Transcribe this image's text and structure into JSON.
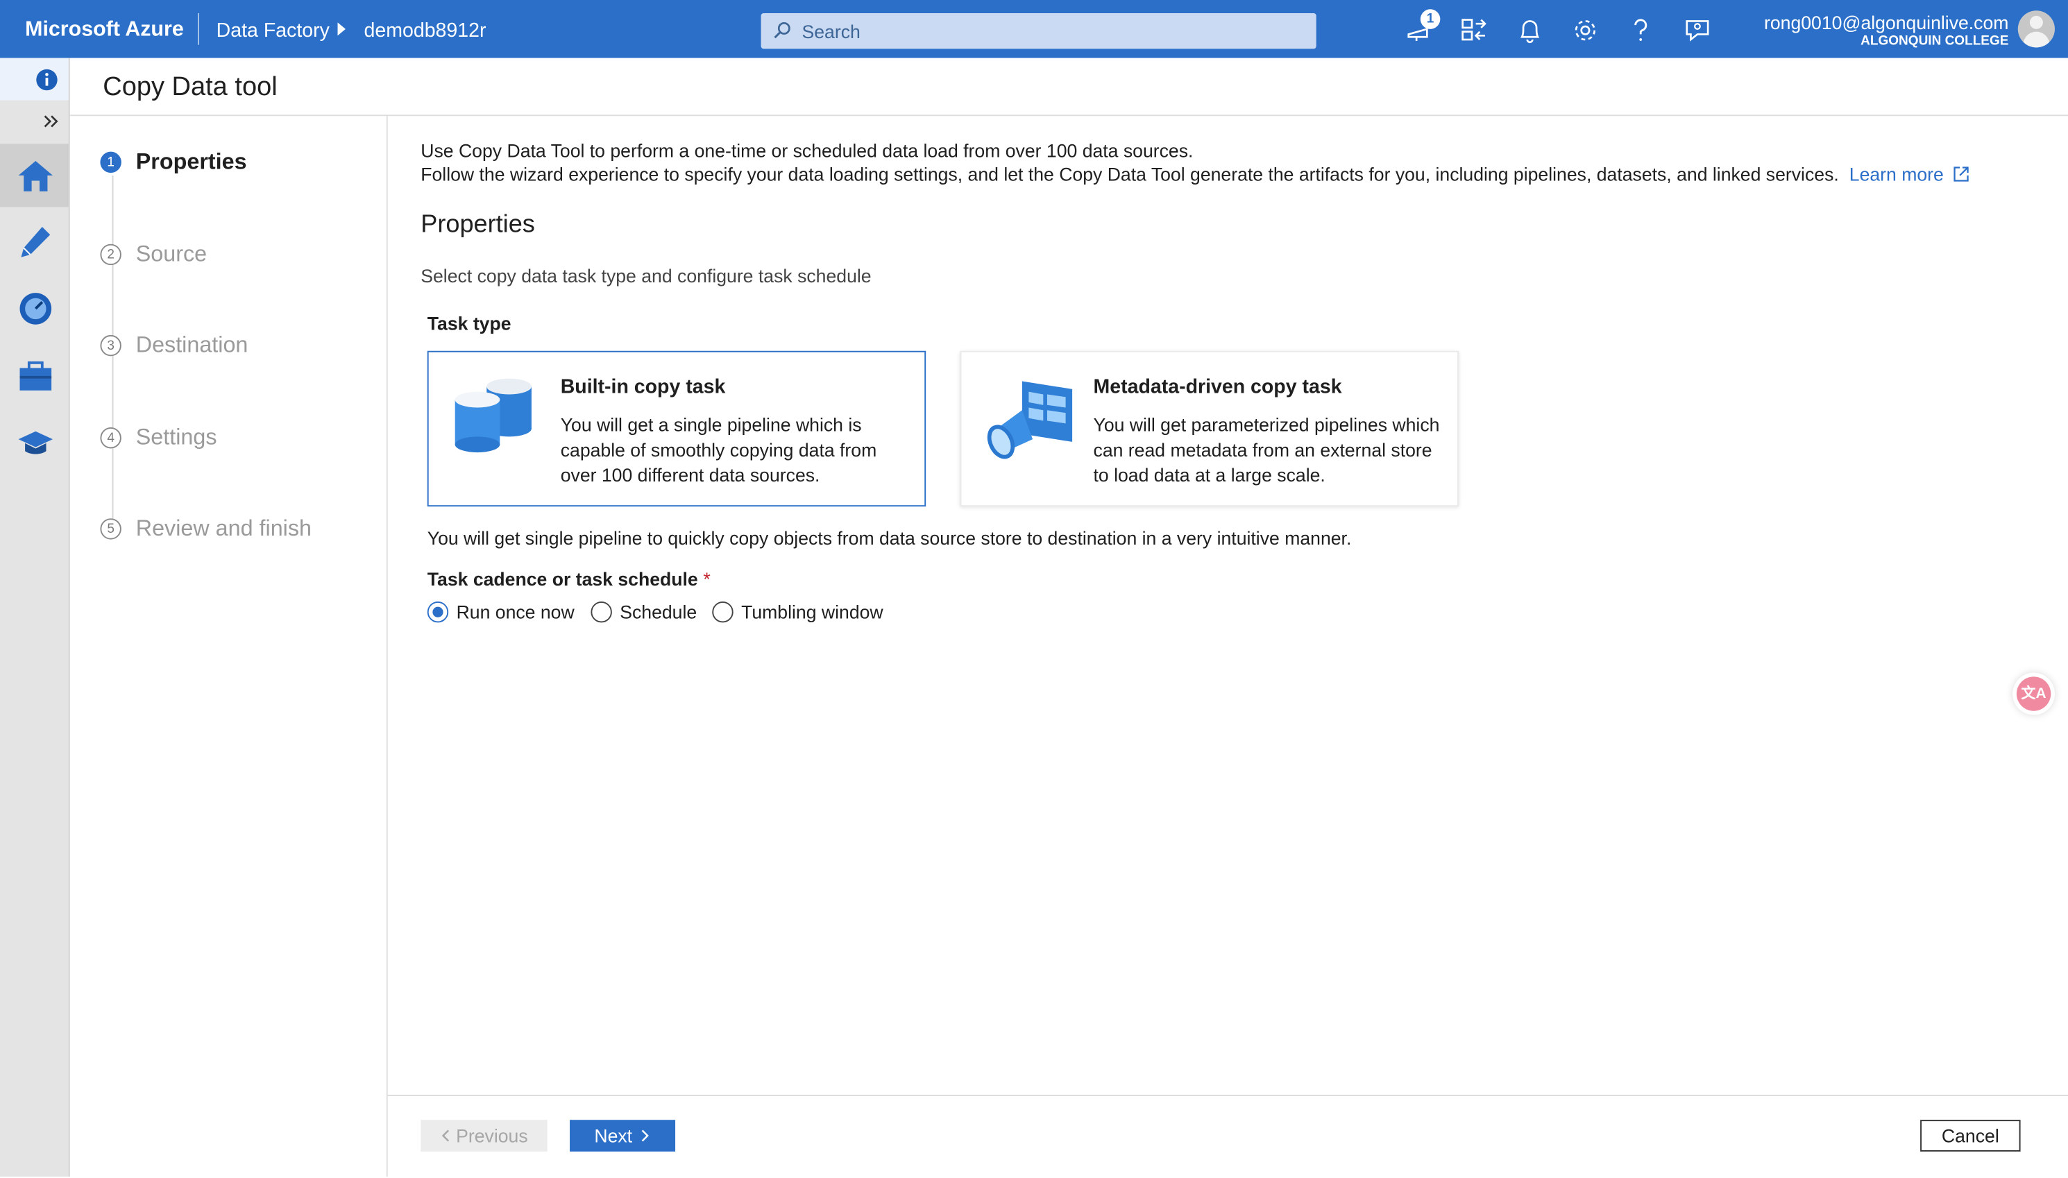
{
  "topbar": {
    "brand": "Microsoft Azure",
    "breadcrumb": [
      "Data Factory",
      "demodb8912r"
    ],
    "search_placeholder": "Search",
    "notification_count": "1",
    "user_email": "rong0010@algonquinlive.com",
    "user_org": "ALGONQUIN COLLEGE",
    "accent_color": "#2b6fc9"
  },
  "rail": {
    "icons": [
      "info-icon",
      "expand-icon",
      "home-icon",
      "author-pencil-icon",
      "monitor-gauge-icon",
      "manage-toolbox-icon",
      "learning-cap-icon"
    ]
  },
  "page": {
    "title": "Copy Data tool"
  },
  "steps": [
    {
      "num": "1",
      "label": "Properties",
      "active": true
    },
    {
      "num": "2",
      "label": "Source"
    },
    {
      "num": "3",
      "label": "Destination"
    },
    {
      "num": "4",
      "label": "Settings"
    },
    {
      "num": "5",
      "label": "Review and finish"
    }
  ],
  "content": {
    "intro_line1": "Use Copy Data Tool to perform a one-time or scheduled data load from over 100 data sources.",
    "intro_line2": "Follow the wizard experience to specify your data loading settings, and let the Copy Data Tool generate the artifacts for you, including pipelines, datasets, and linked services.",
    "learn_more": "Learn more",
    "heading": "Properties",
    "subheading": "Select copy data task type and configure task schedule",
    "task_type_label": "Task type",
    "cards": [
      {
        "title": "Built-in copy task",
        "description": "You will get a single pipeline which is capable of smoothly copying data from over 100 different data sources.",
        "selected": true
      },
      {
        "title": "Metadata-driven copy task",
        "description": "You will get parameterized pipelines which can read metadata from an external store to load data at a large scale.",
        "selected": false
      }
    ],
    "note": "You will get single pipeline to quickly copy objects from data source store to destination in a very intuitive manner.",
    "cadence_label": "Task cadence or task schedule",
    "required_mark": "*",
    "radios": [
      {
        "label": "Run once now",
        "checked": true
      },
      {
        "label": "Schedule",
        "checked": false
      },
      {
        "label": "Tumbling window",
        "checked": false
      }
    ]
  },
  "footer": {
    "previous": "Previous",
    "next": "Next",
    "cancel": "Cancel"
  }
}
